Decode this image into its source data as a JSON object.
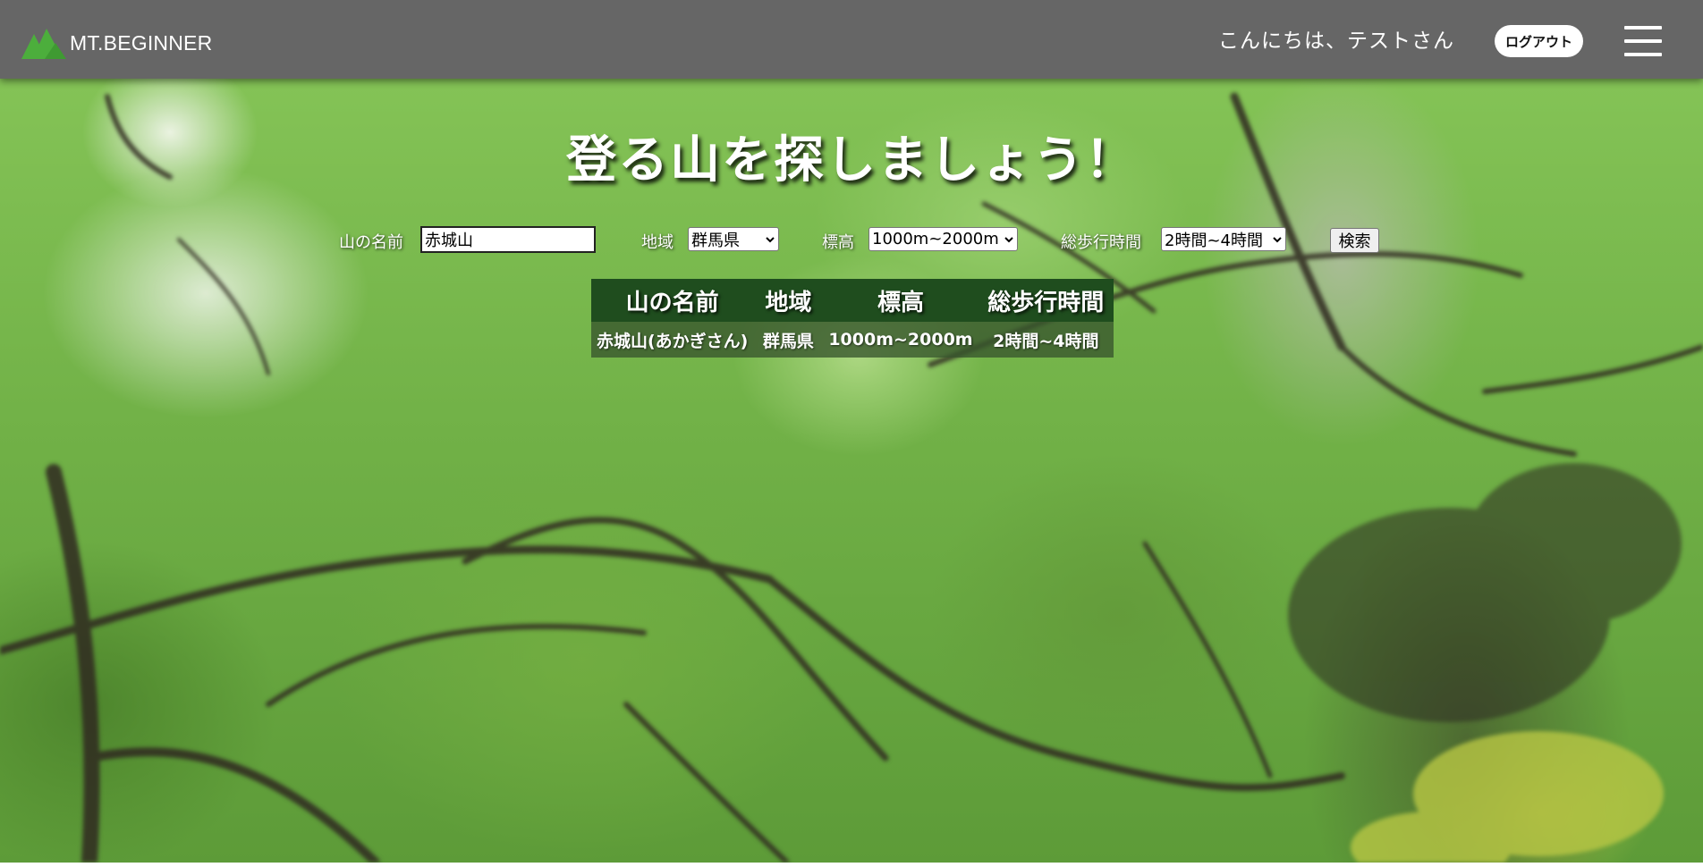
{
  "header": {
    "logo_text": "MT.BEGINNER",
    "greeting": "こんにちは、テストさん",
    "logout_label": "ログアウト",
    "menu_icon": "hamburger-menu-icon",
    "background_color": "#666666"
  },
  "main": {
    "title": "登る山を探しましょう！",
    "search": {
      "name_label": "山の名前",
      "name_value": "赤城山",
      "region_label": "地域",
      "region_selected": "群馬県",
      "elevation_label": "標高",
      "elevation_selected": "1000m~2000m",
      "time_label": "総歩行時間",
      "time_selected": "2時間~4時間",
      "search_label": "検索"
    },
    "results": {
      "headers": [
        "山の名前",
        "地域",
        "標高",
        "総歩行時間"
      ],
      "rows": [
        [
          "赤城山(あかぎさん)",
          "群馬県",
          "1000m~2000m",
          "2時間~4時間"
        ]
      ],
      "header_color": "#1f4d1e"
    }
  },
  "theme": {
    "accent_green": "#4cae3c"
  }
}
